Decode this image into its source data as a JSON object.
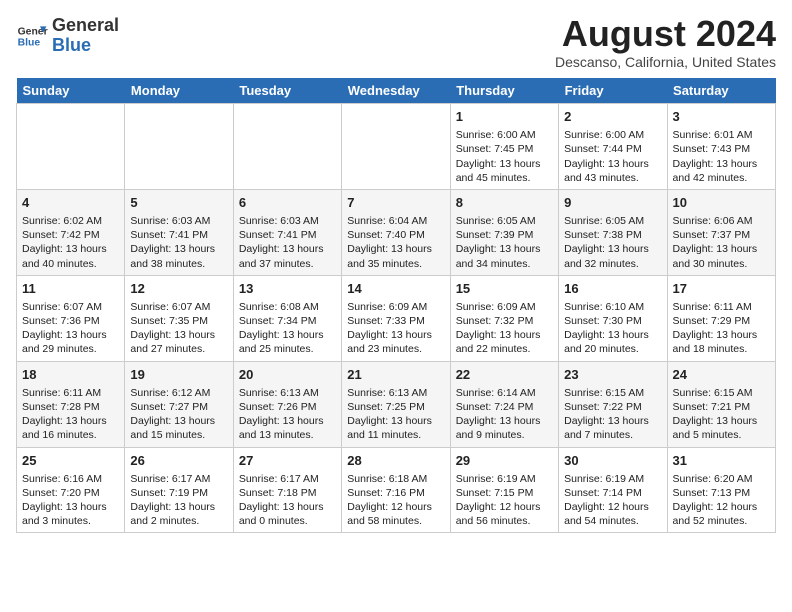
{
  "header": {
    "logo_line1": "General",
    "logo_line2": "Blue",
    "month_year": "August 2024",
    "location": "Descanso, California, United States"
  },
  "days_of_week": [
    "Sunday",
    "Monday",
    "Tuesday",
    "Wednesday",
    "Thursday",
    "Friday",
    "Saturday"
  ],
  "weeks": [
    [
      {
        "day": "",
        "info": ""
      },
      {
        "day": "",
        "info": ""
      },
      {
        "day": "",
        "info": ""
      },
      {
        "day": "",
        "info": ""
      },
      {
        "day": "1",
        "info": "Sunrise: 6:00 AM\nSunset: 7:45 PM\nDaylight: 13 hours\nand 45 minutes."
      },
      {
        "day": "2",
        "info": "Sunrise: 6:00 AM\nSunset: 7:44 PM\nDaylight: 13 hours\nand 43 minutes."
      },
      {
        "day": "3",
        "info": "Sunrise: 6:01 AM\nSunset: 7:43 PM\nDaylight: 13 hours\nand 42 minutes."
      }
    ],
    [
      {
        "day": "4",
        "info": "Sunrise: 6:02 AM\nSunset: 7:42 PM\nDaylight: 13 hours\nand 40 minutes."
      },
      {
        "day": "5",
        "info": "Sunrise: 6:03 AM\nSunset: 7:41 PM\nDaylight: 13 hours\nand 38 minutes."
      },
      {
        "day": "6",
        "info": "Sunrise: 6:03 AM\nSunset: 7:41 PM\nDaylight: 13 hours\nand 37 minutes."
      },
      {
        "day": "7",
        "info": "Sunrise: 6:04 AM\nSunset: 7:40 PM\nDaylight: 13 hours\nand 35 minutes."
      },
      {
        "day": "8",
        "info": "Sunrise: 6:05 AM\nSunset: 7:39 PM\nDaylight: 13 hours\nand 34 minutes."
      },
      {
        "day": "9",
        "info": "Sunrise: 6:05 AM\nSunset: 7:38 PM\nDaylight: 13 hours\nand 32 minutes."
      },
      {
        "day": "10",
        "info": "Sunrise: 6:06 AM\nSunset: 7:37 PM\nDaylight: 13 hours\nand 30 minutes."
      }
    ],
    [
      {
        "day": "11",
        "info": "Sunrise: 6:07 AM\nSunset: 7:36 PM\nDaylight: 13 hours\nand 29 minutes."
      },
      {
        "day": "12",
        "info": "Sunrise: 6:07 AM\nSunset: 7:35 PM\nDaylight: 13 hours\nand 27 minutes."
      },
      {
        "day": "13",
        "info": "Sunrise: 6:08 AM\nSunset: 7:34 PM\nDaylight: 13 hours\nand 25 minutes."
      },
      {
        "day": "14",
        "info": "Sunrise: 6:09 AM\nSunset: 7:33 PM\nDaylight: 13 hours\nand 23 minutes."
      },
      {
        "day": "15",
        "info": "Sunrise: 6:09 AM\nSunset: 7:32 PM\nDaylight: 13 hours\nand 22 minutes."
      },
      {
        "day": "16",
        "info": "Sunrise: 6:10 AM\nSunset: 7:30 PM\nDaylight: 13 hours\nand 20 minutes."
      },
      {
        "day": "17",
        "info": "Sunrise: 6:11 AM\nSunset: 7:29 PM\nDaylight: 13 hours\nand 18 minutes."
      }
    ],
    [
      {
        "day": "18",
        "info": "Sunrise: 6:11 AM\nSunset: 7:28 PM\nDaylight: 13 hours\nand 16 minutes."
      },
      {
        "day": "19",
        "info": "Sunrise: 6:12 AM\nSunset: 7:27 PM\nDaylight: 13 hours\nand 15 minutes."
      },
      {
        "day": "20",
        "info": "Sunrise: 6:13 AM\nSunset: 7:26 PM\nDaylight: 13 hours\nand 13 minutes."
      },
      {
        "day": "21",
        "info": "Sunrise: 6:13 AM\nSunset: 7:25 PM\nDaylight: 13 hours\nand 11 minutes."
      },
      {
        "day": "22",
        "info": "Sunrise: 6:14 AM\nSunset: 7:24 PM\nDaylight: 13 hours\nand 9 minutes."
      },
      {
        "day": "23",
        "info": "Sunrise: 6:15 AM\nSunset: 7:22 PM\nDaylight: 13 hours\nand 7 minutes."
      },
      {
        "day": "24",
        "info": "Sunrise: 6:15 AM\nSunset: 7:21 PM\nDaylight: 13 hours\nand 5 minutes."
      }
    ],
    [
      {
        "day": "25",
        "info": "Sunrise: 6:16 AM\nSunset: 7:20 PM\nDaylight: 13 hours\nand 3 minutes."
      },
      {
        "day": "26",
        "info": "Sunrise: 6:17 AM\nSunset: 7:19 PM\nDaylight: 13 hours\nand 2 minutes."
      },
      {
        "day": "27",
        "info": "Sunrise: 6:17 AM\nSunset: 7:18 PM\nDaylight: 13 hours\nand 0 minutes."
      },
      {
        "day": "28",
        "info": "Sunrise: 6:18 AM\nSunset: 7:16 PM\nDaylight: 12 hours\nand 58 minutes."
      },
      {
        "day": "29",
        "info": "Sunrise: 6:19 AM\nSunset: 7:15 PM\nDaylight: 12 hours\nand 56 minutes."
      },
      {
        "day": "30",
        "info": "Sunrise: 6:19 AM\nSunset: 7:14 PM\nDaylight: 12 hours\nand 54 minutes."
      },
      {
        "day": "31",
        "info": "Sunrise: 6:20 AM\nSunset: 7:13 PM\nDaylight: 12 hours\nand 52 minutes."
      }
    ]
  ]
}
